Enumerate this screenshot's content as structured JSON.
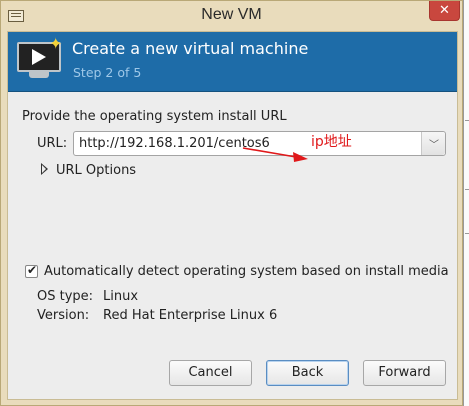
{
  "window": {
    "title": "New VM",
    "close_glyph": "✕"
  },
  "banner": {
    "title": "Create a new virtual machine",
    "step": "Step 2 of 5",
    "icon": "monitor-play-icon"
  },
  "form": {
    "section_label": "Provide the operating system install URL",
    "url_label": "URL:",
    "url_value": "http://192.168.1.201/centos6",
    "url_options_label": "URL Options",
    "autodetect_label": "Automatically detect operating system based on install media",
    "autodetect_checked": true,
    "os_type_label": "OS type:",
    "os_type_value": "Linux",
    "version_label": "Version:",
    "version_value": "Red Hat Enterprise Linux 6"
  },
  "annotation": {
    "text": "ip地址",
    "color": "#e0181a"
  },
  "buttons": {
    "cancel": "Cancel",
    "back": "Back",
    "forward": "Forward"
  },
  "colors": {
    "banner": "#1e6ca8",
    "close_button": "#c9473e",
    "window_frame": "#e9dcbc"
  }
}
